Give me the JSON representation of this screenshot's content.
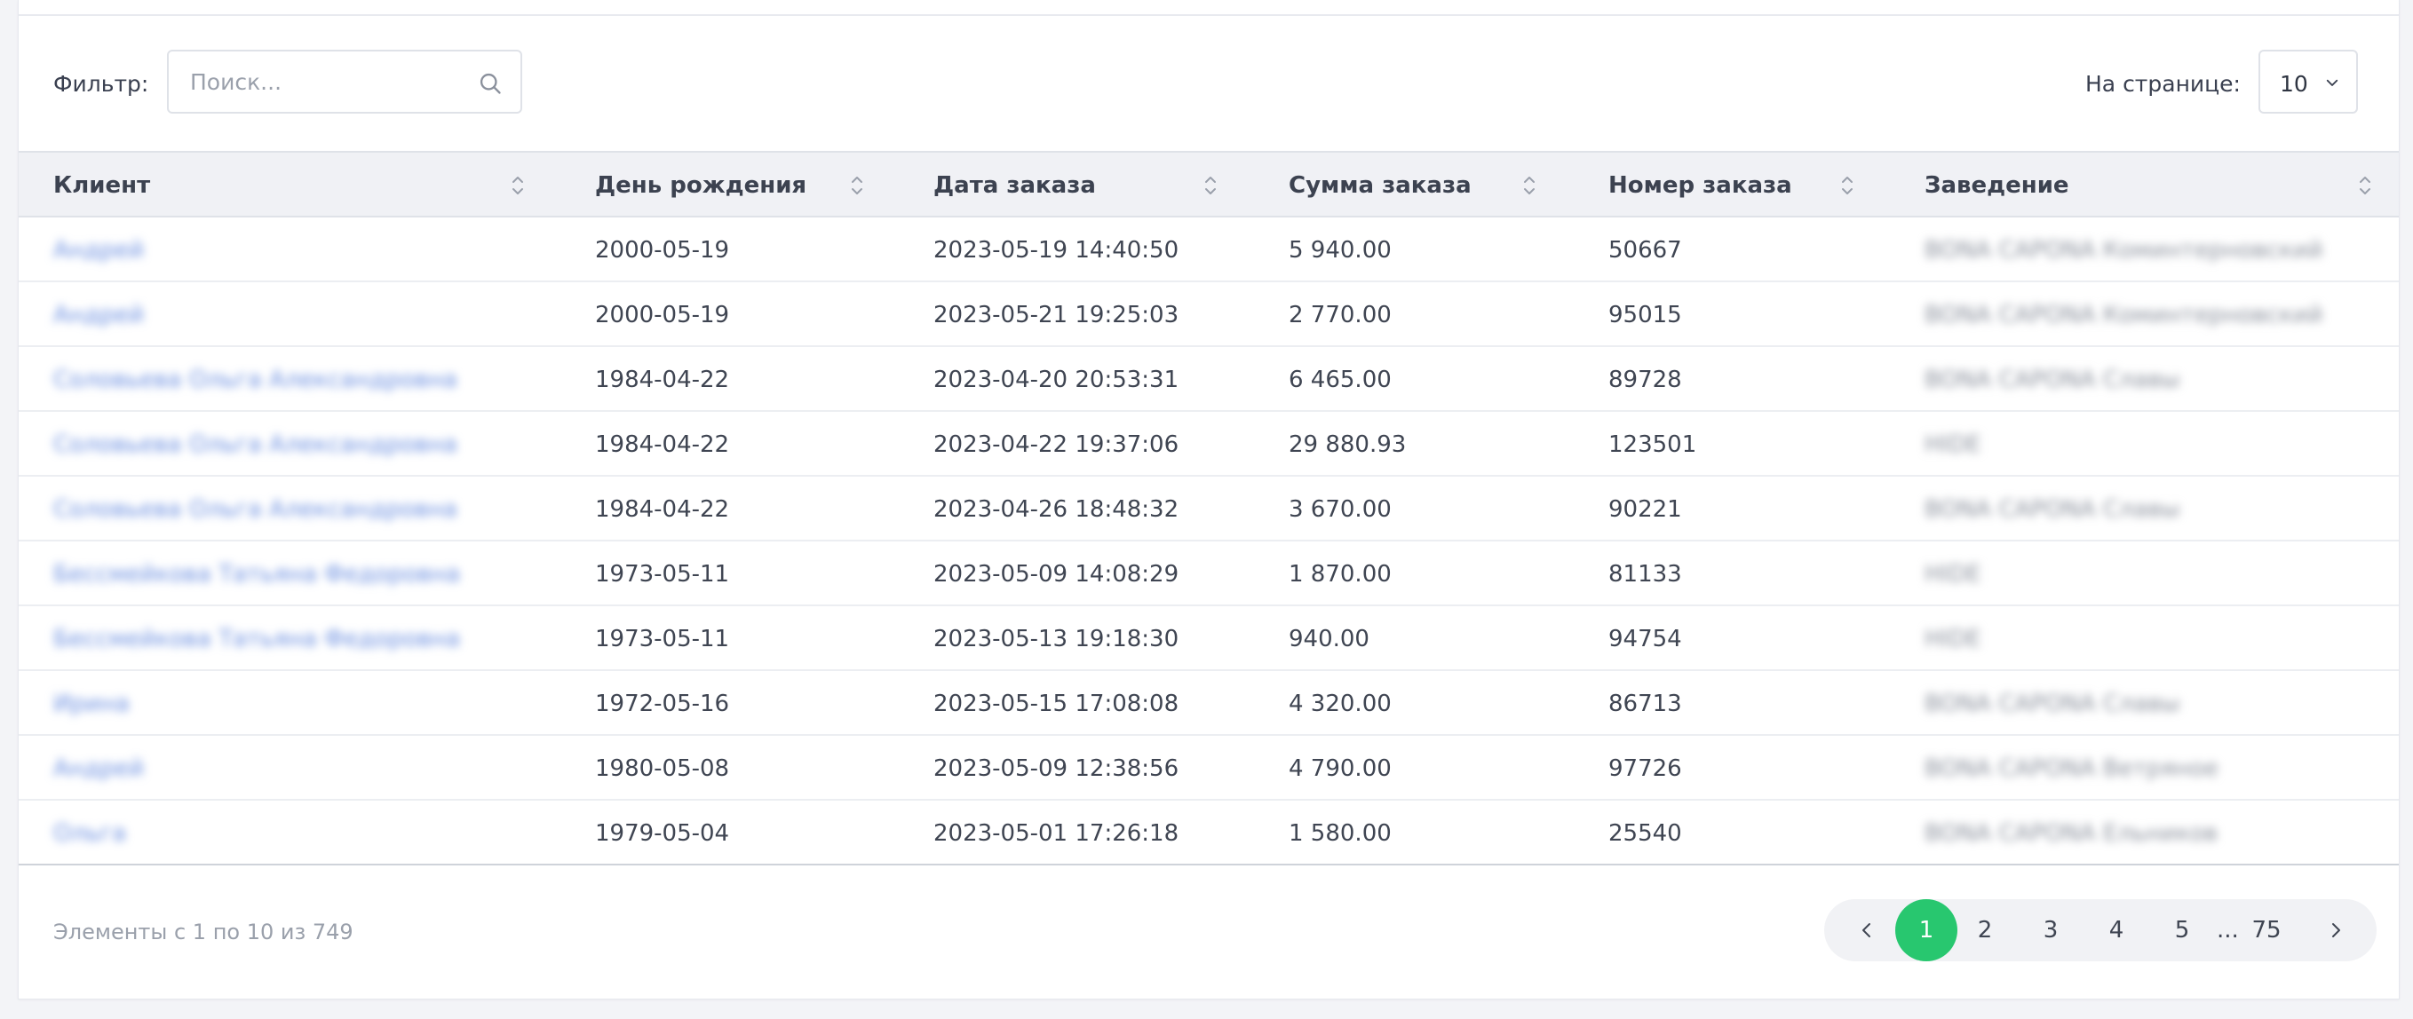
{
  "filter": {
    "label": "Фильтр:",
    "placeholder": "Поиск...",
    "value": ""
  },
  "per_page": {
    "label": "На странице:",
    "value": "10"
  },
  "columns": [
    "Клиент",
    "День рождения",
    "Дата заказа",
    "Сумма заказа",
    "Номер заказа",
    "Заведение"
  ],
  "rows": [
    {
      "client": "Андрей",
      "birthday": "2000-05-19",
      "order_date": "2023-05-19 14:40:50",
      "amount": "5 940.00",
      "order_no": "50667",
      "venue": "BONA CAPONA Коминтерновский"
    },
    {
      "client": "Андрей",
      "birthday": "2000-05-19",
      "order_date": "2023-05-21 19:25:03",
      "amount": "2 770.00",
      "order_no": "95015",
      "venue": "BONA CAPONA Коминтерновский"
    },
    {
      "client": "Соловьева Ольга Александровна",
      "birthday": "1984-04-22",
      "order_date": "2023-04-20 20:53:31",
      "amount": "6 465.00",
      "order_no": "89728",
      "venue": "BONA CAPONA Славы"
    },
    {
      "client": "Соловьева Ольга Александровна",
      "birthday": "1984-04-22",
      "order_date": "2023-04-22 19:37:06",
      "amount": "29 880.93",
      "order_no": "123501",
      "venue": "HIDE"
    },
    {
      "client": "Соловьева Ольга Александровна",
      "birthday": "1984-04-22",
      "order_date": "2023-04-26 18:48:32",
      "amount": "3 670.00",
      "order_no": "90221",
      "venue": "BONA CAPONA Славы"
    },
    {
      "client": "Бессмейкова Татьяна Федоровна",
      "birthday": "1973-05-11",
      "order_date": "2023-05-09 14:08:29",
      "amount": "1 870.00",
      "order_no": "81133",
      "venue": "HIDE"
    },
    {
      "client": "Бессмейкова Татьяна Федоровна",
      "birthday": "1973-05-11",
      "order_date": "2023-05-13 19:18:30",
      "amount": "940.00",
      "order_no": "94754",
      "venue": "HIDE"
    },
    {
      "client": "Ирина",
      "birthday": "1972-05-16",
      "order_date": "2023-05-15 17:08:08",
      "amount": "4 320.00",
      "order_no": "86713",
      "venue": "BONA CAPONA Славы"
    },
    {
      "client": "Андрей",
      "birthday": "1980-05-08",
      "order_date": "2023-05-09 12:38:56",
      "amount": "4 790.00",
      "order_no": "97726",
      "venue": "BONA CAPONA Ветряное"
    },
    {
      "client": "Ольга",
      "birthday": "1979-05-04",
      "order_date": "2023-05-01 17:26:18",
      "amount": "1 580.00",
      "order_no": "25540",
      "venue": "BONA CAPONA Ельников"
    }
  ],
  "footer": {
    "info": "Элементы с 1 по 10 из 749"
  },
  "pagination": {
    "pages": [
      "1",
      "2",
      "3",
      "4",
      "5"
    ],
    "ellipsis": "...",
    "last": "75",
    "active": "1"
  },
  "colors": {
    "accent": "#28c76f",
    "link": "#6a8ee0",
    "header_bg": "#f0f1f5"
  }
}
